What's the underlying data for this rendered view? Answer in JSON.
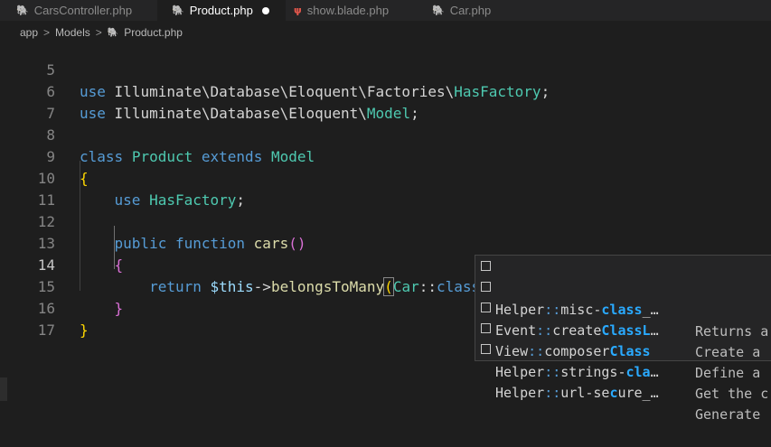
{
  "tabs": [
    {
      "label": "CarsController.php",
      "active": false,
      "icon": "php-elephant-icon"
    },
    {
      "label": "Product.php",
      "active": true,
      "icon": "php-elephant-icon",
      "dirty": true
    },
    {
      "label": "show.blade.php",
      "active": false,
      "icon": "laravel-blade-icon"
    },
    {
      "label": "Car.php",
      "active": false,
      "icon": "php-elephant-icon"
    }
  ],
  "breadcrumb": {
    "app": "app",
    "models": "Models",
    "file": "Product.php"
  },
  "lines": [
    {
      "n": "5",
      "t": "use Illuminate\\Database\\Eloquent\\Factories\\HasFactory;"
    },
    {
      "n": "6",
      "t": "use Illuminate\\Database\\Eloquent\\Model;"
    },
    {
      "n": "7",
      "t": ""
    },
    {
      "n": "8",
      "t": "class Product extends Model"
    },
    {
      "n": "9",
      "t": "{"
    },
    {
      "n": "10",
      "t": "    use HasFactory;"
    },
    {
      "n": "11",
      "t": ""
    },
    {
      "n": "12",
      "t": "    public function cars()"
    },
    {
      "n": "13",
      "t": "    {"
    },
    {
      "n": "14",
      "t": "        return $this->belongsToMany(Car::class);"
    },
    {
      "n": "15",
      "t": "    }"
    },
    {
      "n": "16",
      "t": "}"
    },
    {
      "n": "17",
      "t": ""
    }
  ],
  "tokens": {
    "use": "use",
    "ns1": "Illuminate\\Database\\Eloquent\\Factories\\",
    "hasFactory": "HasFactory",
    "semi": ";",
    "ns2": "Illuminate\\Database\\Eloquent\\",
    "model": "Model",
    "class": "class",
    "product": "Product",
    "extends": "extends",
    "open": "{",
    "close": "}",
    "public": "public",
    "function": "function",
    "cars": "cars",
    "parens": "()",
    "return": "return",
    "this": "$this",
    "arrow": "->",
    "belongs": "belongsToMany",
    "lparen": "(",
    "car": "Car",
    "dcolon": "::",
    "classkw": "class",
    "rparen": ")"
  },
  "suggestions": [
    {
      "pre": "Helper",
      "sep": "::",
      "mid": "misc-",
      "hl": "class",
      "post": "_…",
      "detail": "Returns a"
    },
    {
      "pre": "Event",
      "sep": "::",
      "mid": "create",
      "hl": "ClassL",
      "post": "…",
      "detail": "Create a"
    },
    {
      "pre": "View",
      "sep": "::",
      "mid": "composer",
      "hl": "Class",
      "post": "",
      "detail": "Define a"
    },
    {
      "pre": "Helper",
      "sep": "::",
      "mid": "strings-",
      "hl": "cla",
      "post": "…",
      "detail": "Get the c"
    },
    {
      "pre": "Helper",
      "sep": "::",
      "mid": "url-se",
      "hl": "c",
      "post": "ure_…",
      "detail": "Generate"
    }
  ],
  "colors": {
    "keyword": "#569cd6",
    "class": "#4ec9b0",
    "function": "#dcdcaa",
    "variable": "#9cdcfe",
    "match": "#2aaaff"
  }
}
